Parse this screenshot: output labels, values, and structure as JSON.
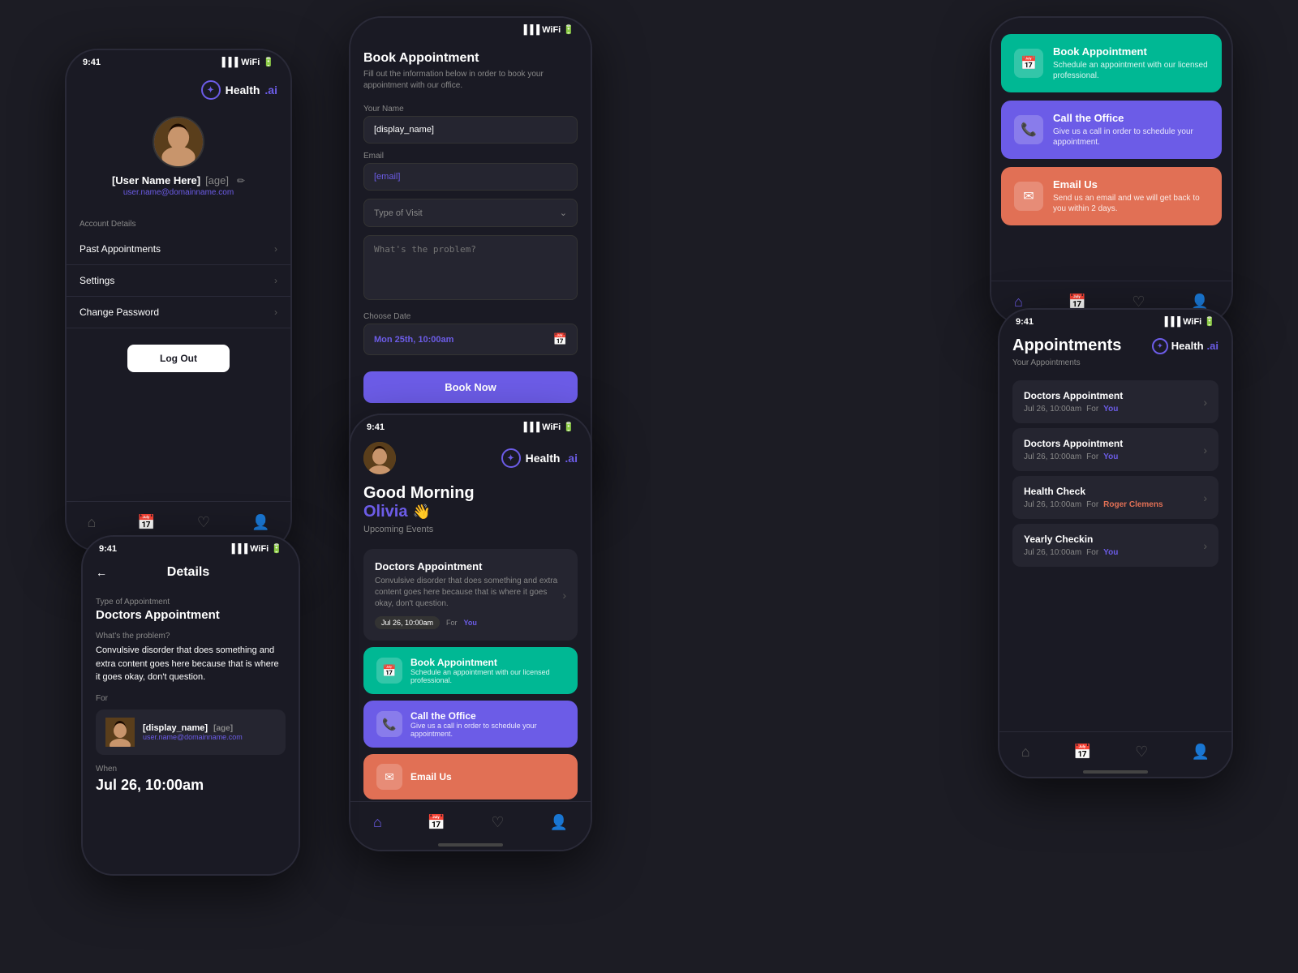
{
  "app": {
    "name": "Health",
    "name_accent": ".ai",
    "time": "9:41"
  },
  "profile": {
    "user_name": "[User Name Here]",
    "user_age": "[age]",
    "user_email": "user.name@domainname.com",
    "account_label": "Account Details",
    "menu_items": [
      "Past Appointments",
      "Settings",
      "Change Password"
    ],
    "logout_label": "Log Out"
  },
  "book": {
    "title": "Book Appointment",
    "subtitle": "Fill out the information below in order to book your appointment with our office.",
    "name_label": "Your Name",
    "name_value": "[display_name]",
    "email_label": "Email",
    "email_value": "[email]",
    "type_label": "Type of Visit",
    "type_placeholder": "Type of Visit",
    "problem_placeholder": "What's the problem?",
    "date_label": "Choose Date",
    "date_value": "Mon 25th, 10:00am",
    "book_btn": "Book Now"
  },
  "options": {
    "book_title": "Book Appointment",
    "book_desc": "Schedule an appointment with our licensed professional.",
    "call_title": "Call the Office",
    "call_desc": "Give us a call in order to schedule your appointment.",
    "email_title": "Email Us",
    "email_desc": "Send us an email and we will get back to you within 2 days."
  },
  "health": {
    "greeting_top": "Good Morning",
    "greeting_name": "Olivia",
    "greeting_wave": "👋",
    "upcoming_label": "Upcoming Events",
    "appointment": {
      "title": "Doctors Appointment",
      "desc": "Convulsive disorder that does something and extra content goes here because that is where it goes okay, don't question.",
      "date": "Jul 26, 10:00am",
      "for_label": "For",
      "for_name": "You"
    }
  },
  "details": {
    "title": "Details",
    "appt_type": "Type of Appointment",
    "appt_name": "Doctors Appointment",
    "problem_label": "What's the problem?",
    "problem_text": "Convulsive disorder that does something and extra content goes here because that is where it goes okay, don't question.",
    "for_label": "For",
    "for_name": "[display_name]",
    "for_age": "[age]",
    "for_email": "user.name@domainname.com",
    "when_label": "When",
    "when_value": "Jul 26, 10:00am"
  },
  "appointments": {
    "title": "Appointments",
    "sub_label": "Your Appointments",
    "items": [
      {
        "title": "Doctors Appointment",
        "date": "Jul 26, 10:00am",
        "for_label": "For",
        "for_name": "You",
        "for_color": "purple"
      },
      {
        "title": "Doctors Appointment",
        "date": "Jul 26, 10:00am",
        "for_label": "For",
        "for_name": "You",
        "for_color": "purple"
      },
      {
        "title": "Health Check",
        "date": "Jul 26, 10:00am",
        "for_label": "For",
        "for_name": "Roger Clemens",
        "for_color": "orange"
      },
      {
        "title": "Yearly Checkin",
        "date": "Jul 26, 10:00am",
        "for_label": "For",
        "for_name": "You",
        "for_color": "purple"
      }
    ]
  }
}
